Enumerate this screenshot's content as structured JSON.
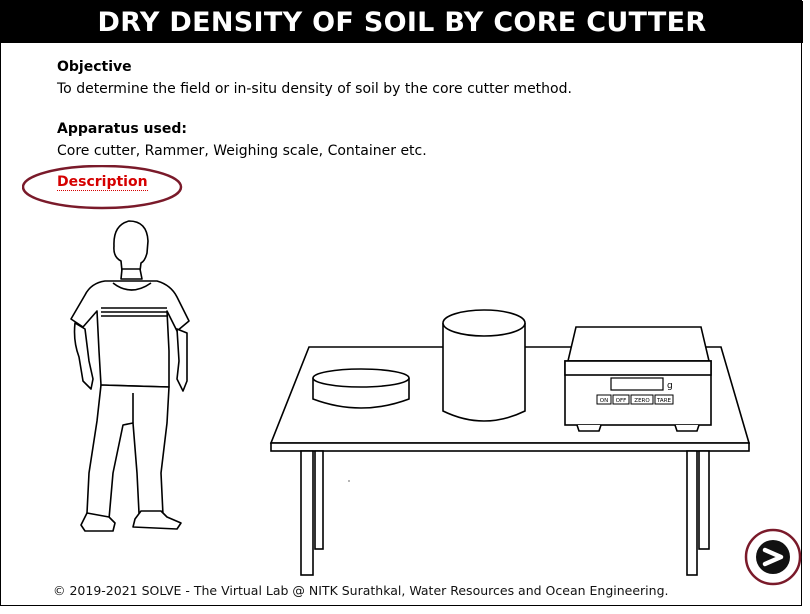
{
  "title": "DRY DENSITY OF SOIL BY CORE CUTTER",
  "objective": {
    "heading": "Objective",
    "text": "To determine the field or in-situ density of soil by the core cutter method."
  },
  "apparatus": {
    "heading": "Apparatus used:",
    "text": "Core cutter, Rammer, Weighing scale, Container etc."
  },
  "description_link": "Description",
  "scale": {
    "unit": "g",
    "buttons": [
      "ON",
      "OFF",
      "ZERO",
      "TARE"
    ]
  },
  "colors": {
    "title_bg": "#000000",
    "link": "#d50000",
    "highlight_ring": "#7a1a2a"
  },
  "footer": "© 2019-2021 SOLVE - The Virtual Lab @ NITK Surathkal, Water Resources and Ocean Engineering.",
  "icons": {
    "next": "next-arrow-icon"
  }
}
